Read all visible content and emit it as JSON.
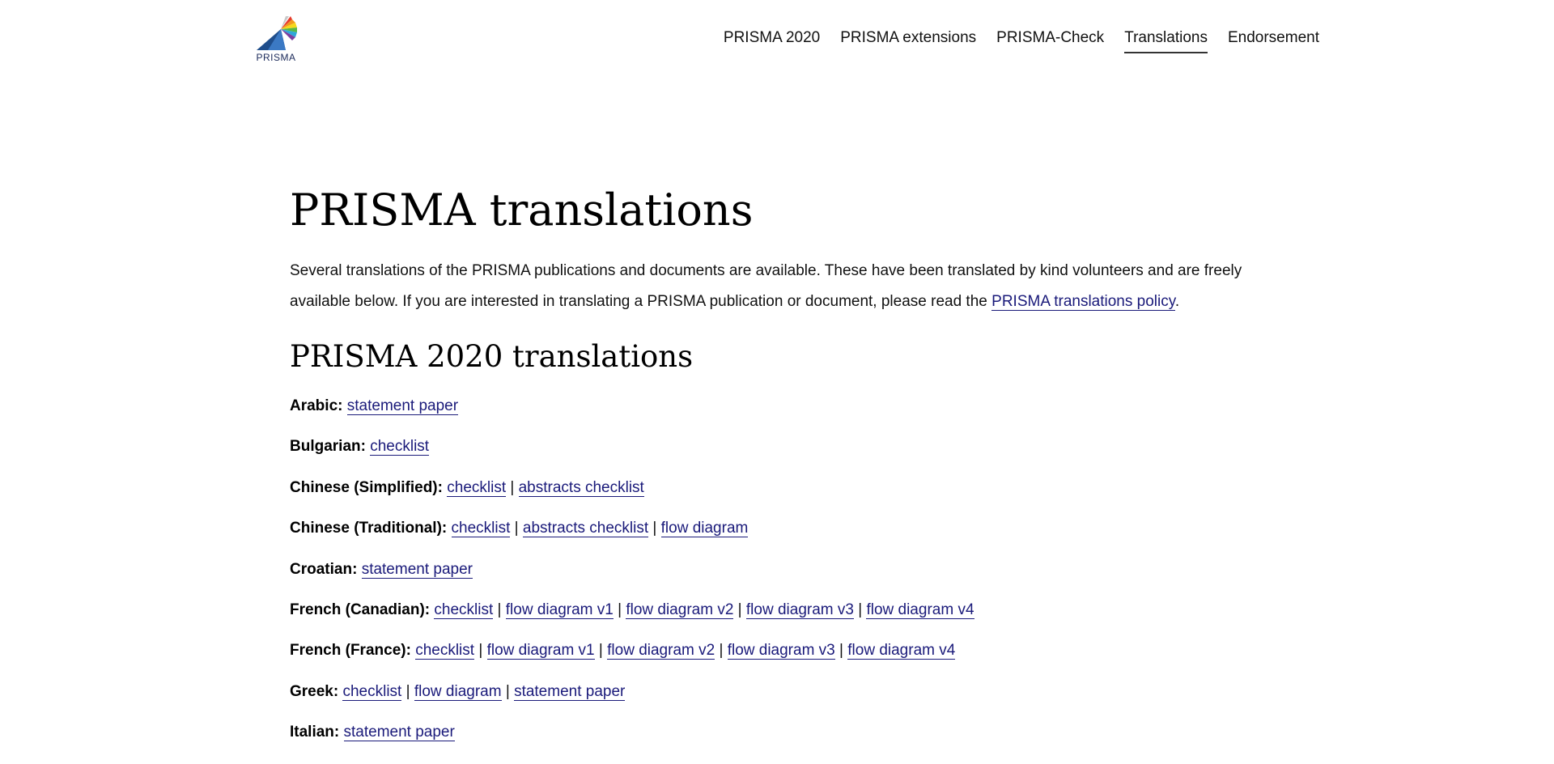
{
  "header": {
    "logo_text": "PRISMA",
    "nav": [
      {
        "label": "PRISMA 2020",
        "active": false
      },
      {
        "label": "PRISMA extensions",
        "active": false
      },
      {
        "label": "PRISMA-Check",
        "active": false
      },
      {
        "label": "Translations",
        "active": true
      },
      {
        "label": "Endorsement",
        "active": false
      }
    ]
  },
  "main": {
    "title": "PRISMA translations",
    "intro_text": "Several translations of the PRISMA publications and documents are available. These have been translated by kind volunteers and are freely available below. If you are interested in translating a PRISMA publication or document, please read the ",
    "intro_link": "PRISMA translations policy",
    "intro_end": ".",
    "section_title": "PRISMA 2020 translations",
    "translations": [
      {
        "language": "Arabic:",
        "links": [
          "statement paper"
        ]
      },
      {
        "language": "Bulgarian:",
        "links": [
          "checklist"
        ]
      },
      {
        "language": "Chinese (Simplified):",
        "links": [
          "checklist",
          "abstracts checklist"
        ]
      },
      {
        "language": "Chinese (Traditional):",
        "links": [
          "checklist",
          "abstracts checklist",
          "flow diagram"
        ]
      },
      {
        "language": "Croatian:",
        "links": [
          "statement paper"
        ]
      },
      {
        "language": "French (Canadian):",
        "links": [
          "checklist",
          "flow diagram v1",
          "flow diagram v2",
          "flow diagram v3",
          "flow diagram v4"
        ]
      },
      {
        "language": "French (France):",
        "links": [
          "checklist",
          "flow diagram v1",
          "flow diagram v2",
          "flow diagram v3",
          "flow diagram v4"
        ]
      },
      {
        "language": "Greek:",
        "links": [
          "checklist",
          "flow diagram",
          "statement paper"
        ]
      },
      {
        "language": "Italian:",
        "links": [
          "statement paper"
        ]
      }
    ],
    "separator": "|"
  },
  "colors": {
    "link": "#1a1a7a",
    "text": "#111111",
    "active_underline": "#333333"
  },
  "icons": {
    "logo": "prisma-logo-icon"
  }
}
